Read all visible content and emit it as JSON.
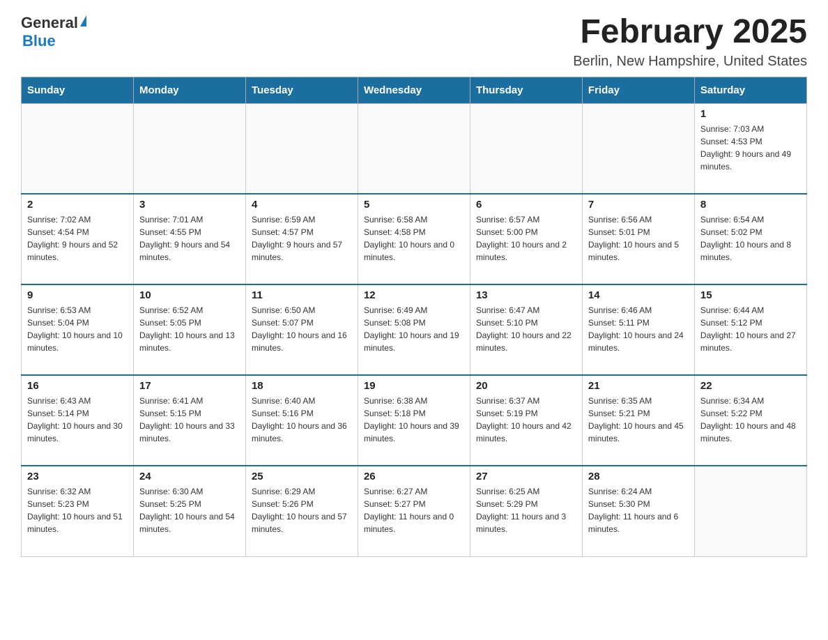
{
  "header": {
    "logo_general": "General",
    "logo_blue": "Blue",
    "month_title": "February 2025",
    "location": "Berlin, New Hampshire, United States"
  },
  "weekdays": [
    "Sunday",
    "Monday",
    "Tuesday",
    "Wednesday",
    "Thursday",
    "Friday",
    "Saturday"
  ],
  "weeks": [
    [
      {
        "day": "",
        "sunrise": "",
        "sunset": "",
        "daylight": ""
      },
      {
        "day": "",
        "sunrise": "",
        "sunset": "",
        "daylight": ""
      },
      {
        "day": "",
        "sunrise": "",
        "sunset": "",
        "daylight": ""
      },
      {
        "day": "",
        "sunrise": "",
        "sunset": "",
        "daylight": ""
      },
      {
        "day": "",
        "sunrise": "",
        "sunset": "",
        "daylight": ""
      },
      {
        "day": "",
        "sunrise": "",
        "sunset": "",
        "daylight": ""
      },
      {
        "day": "1",
        "sunrise": "Sunrise: 7:03 AM",
        "sunset": "Sunset: 4:53 PM",
        "daylight": "Daylight: 9 hours and 49 minutes."
      }
    ],
    [
      {
        "day": "2",
        "sunrise": "Sunrise: 7:02 AM",
        "sunset": "Sunset: 4:54 PM",
        "daylight": "Daylight: 9 hours and 52 minutes."
      },
      {
        "day": "3",
        "sunrise": "Sunrise: 7:01 AM",
        "sunset": "Sunset: 4:55 PM",
        "daylight": "Daylight: 9 hours and 54 minutes."
      },
      {
        "day": "4",
        "sunrise": "Sunrise: 6:59 AM",
        "sunset": "Sunset: 4:57 PM",
        "daylight": "Daylight: 9 hours and 57 minutes."
      },
      {
        "day": "5",
        "sunrise": "Sunrise: 6:58 AM",
        "sunset": "Sunset: 4:58 PM",
        "daylight": "Daylight: 10 hours and 0 minutes."
      },
      {
        "day": "6",
        "sunrise": "Sunrise: 6:57 AM",
        "sunset": "Sunset: 5:00 PM",
        "daylight": "Daylight: 10 hours and 2 minutes."
      },
      {
        "day": "7",
        "sunrise": "Sunrise: 6:56 AM",
        "sunset": "Sunset: 5:01 PM",
        "daylight": "Daylight: 10 hours and 5 minutes."
      },
      {
        "day": "8",
        "sunrise": "Sunrise: 6:54 AM",
        "sunset": "Sunset: 5:02 PM",
        "daylight": "Daylight: 10 hours and 8 minutes."
      }
    ],
    [
      {
        "day": "9",
        "sunrise": "Sunrise: 6:53 AM",
        "sunset": "Sunset: 5:04 PM",
        "daylight": "Daylight: 10 hours and 10 minutes."
      },
      {
        "day": "10",
        "sunrise": "Sunrise: 6:52 AM",
        "sunset": "Sunset: 5:05 PM",
        "daylight": "Daylight: 10 hours and 13 minutes."
      },
      {
        "day": "11",
        "sunrise": "Sunrise: 6:50 AM",
        "sunset": "Sunset: 5:07 PM",
        "daylight": "Daylight: 10 hours and 16 minutes."
      },
      {
        "day": "12",
        "sunrise": "Sunrise: 6:49 AM",
        "sunset": "Sunset: 5:08 PM",
        "daylight": "Daylight: 10 hours and 19 minutes."
      },
      {
        "day": "13",
        "sunrise": "Sunrise: 6:47 AM",
        "sunset": "Sunset: 5:10 PM",
        "daylight": "Daylight: 10 hours and 22 minutes."
      },
      {
        "day": "14",
        "sunrise": "Sunrise: 6:46 AM",
        "sunset": "Sunset: 5:11 PM",
        "daylight": "Daylight: 10 hours and 24 minutes."
      },
      {
        "day": "15",
        "sunrise": "Sunrise: 6:44 AM",
        "sunset": "Sunset: 5:12 PM",
        "daylight": "Daylight: 10 hours and 27 minutes."
      }
    ],
    [
      {
        "day": "16",
        "sunrise": "Sunrise: 6:43 AM",
        "sunset": "Sunset: 5:14 PM",
        "daylight": "Daylight: 10 hours and 30 minutes."
      },
      {
        "day": "17",
        "sunrise": "Sunrise: 6:41 AM",
        "sunset": "Sunset: 5:15 PM",
        "daylight": "Daylight: 10 hours and 33 minutes."
      },
      {
        "day": "18",
        "sunrise": "Sunrise: 6:40 AM",
        "sunset": "Sunset: 5:16 PM",
        "daylight": "Daylight: 10 hours and 36 minutes."
      },
      {
        "day": "19",
        "sunrise": "Sunrise: 6:38 AM",
        "sunset": "Sunset: 5:18 PM",
        "daylight": "Daylight: 10 hours and 39 minutes."
      },
      {
        "day": "20",
        "sunrise": "Sunrise: 6:37 AM",
        "sunset": "Sunset: 5:19 PM",
        "daylight": "Daylight: 10 hours and 42 minutes."
      },
      {
        "day": "21",
        "sunrise": "Sunrise: 6:35 AM",
        "sunset": "Sunset: 5:21 PM",
        "daylight": "Daylight: 10 hours and 45 minutes."
      },
      {
        "day": "22",
        "sunrise": "Sunrise: 6:34 AM",
        "sunset": "Sunset: 5:22 PM",
        "daylight": "Daylight: 10 hours and 48 minutes."
      }
    ],
    [
      {
        "day": "23",
        "sunrise": "Sunrise: 6:32 AM",
        "sunset": "Sunset: 5:23 PM",
        "daylight": "Daylight: 10 hours and 51 minutes."
      },
      {
        "day": "24",
        "sunrise": "Sunrise: 6:30 AM",
        "sunset": "Sunset: 5:25 PM",
        "daylight": "Daylight: 10 hours and 54 minutes."
      },
      {
        "day": "25",
        "sunrise": "Sunrise: 6:29 AM",
        "sunset": "Sunset: 5:26 PM",
        "daylight": "Daylight: 10 hours and 57 minutes."
      },
      {
        "day": "26",
        "sunrise": "Sunrise: 6:27 AM",
        "sunset": "Sunset: 5:27 PM",
        "daylight": "Daylight: 11 hours and 0 minutes."
      },
      {
        "day": "27",
        "sunrise": "Sunrise: 6:25 AM",
        "sunset": "Sunset: 5:29 PM",
        "daylight": "Daylight: 11 hours and 3 minutes."
      },
      {
        "day": "28",
        "sunrise": "Sunrise: 6:24 AM",
        "sunset": "Sunset: 5:30 PM",
        "daylight": "Daylight: 11 hours and 6 minutes."
      },
      {
        "day": "",
        "sunrise": "",
        "sunset": "",
        "daylight": ""
      }
    ]
  ]
}
